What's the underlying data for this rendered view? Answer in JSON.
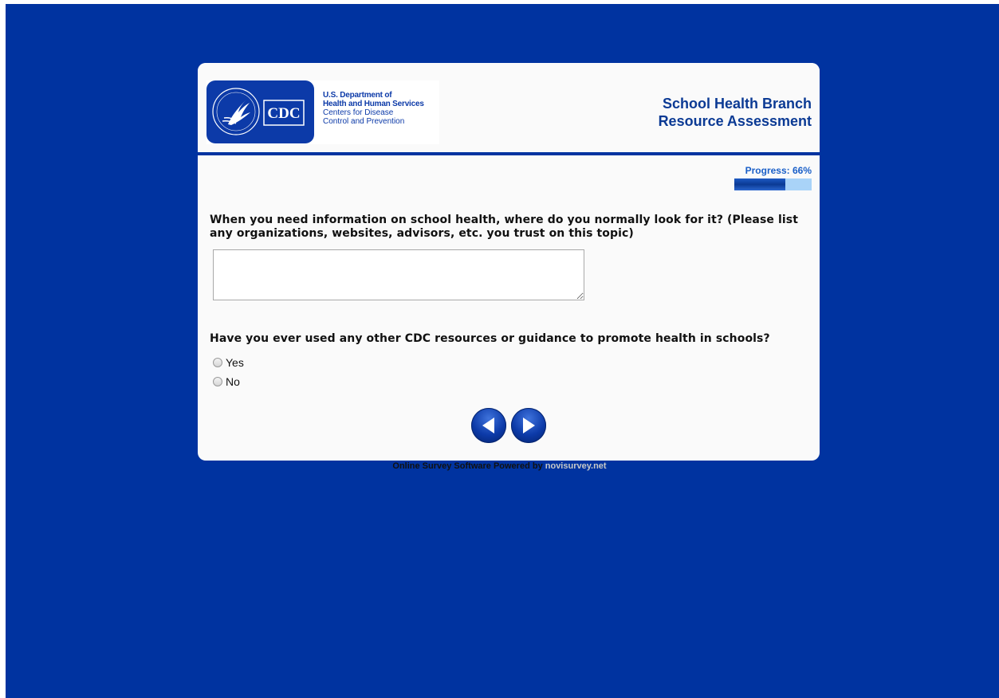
{
  "header": {
    "seal_text": "CDC",
    "agency_lines": [
      "U.S. Department of",
      "Health and Human Services",
      "Centers for Disease",
      "Control and Prevention"
    ],
    "title_line1": "School Health Branch",
    "title_line2": "Resource Assessment"
  },
  "progress": {
    "label": "Progress: 66%",
    "value": 0.66
  },
  "questions": [
    {
      "text": "When you need information on school health, where do you normally look for it? (Please list any organizations, websites, advisors, etc. you trust on this topic)",
      "answer_value": ""
    },
    {
      "text": "Have you ever used any other CDC resources or guidance to promote health in schools?",
      "options": [
        "Yes",
        "No"
      ]
    }
  ],
  "navigation": {
    "back_icon": "arrow-left-icon",
    "next_icon": "arrow-right-icon"
  },
  "footer": {
    "text": "Online Survey Software Powered by",
    "link": "novisurvey.net"
  },
  "colors": {
    "page_background": "#0033a0",
    "card_background": "#fafafa",
    "title_blue": "#0b3a94",
    "progress_blue": "#1a5fc8",
    "progress_track": "#a9d3f8"
  }
}
